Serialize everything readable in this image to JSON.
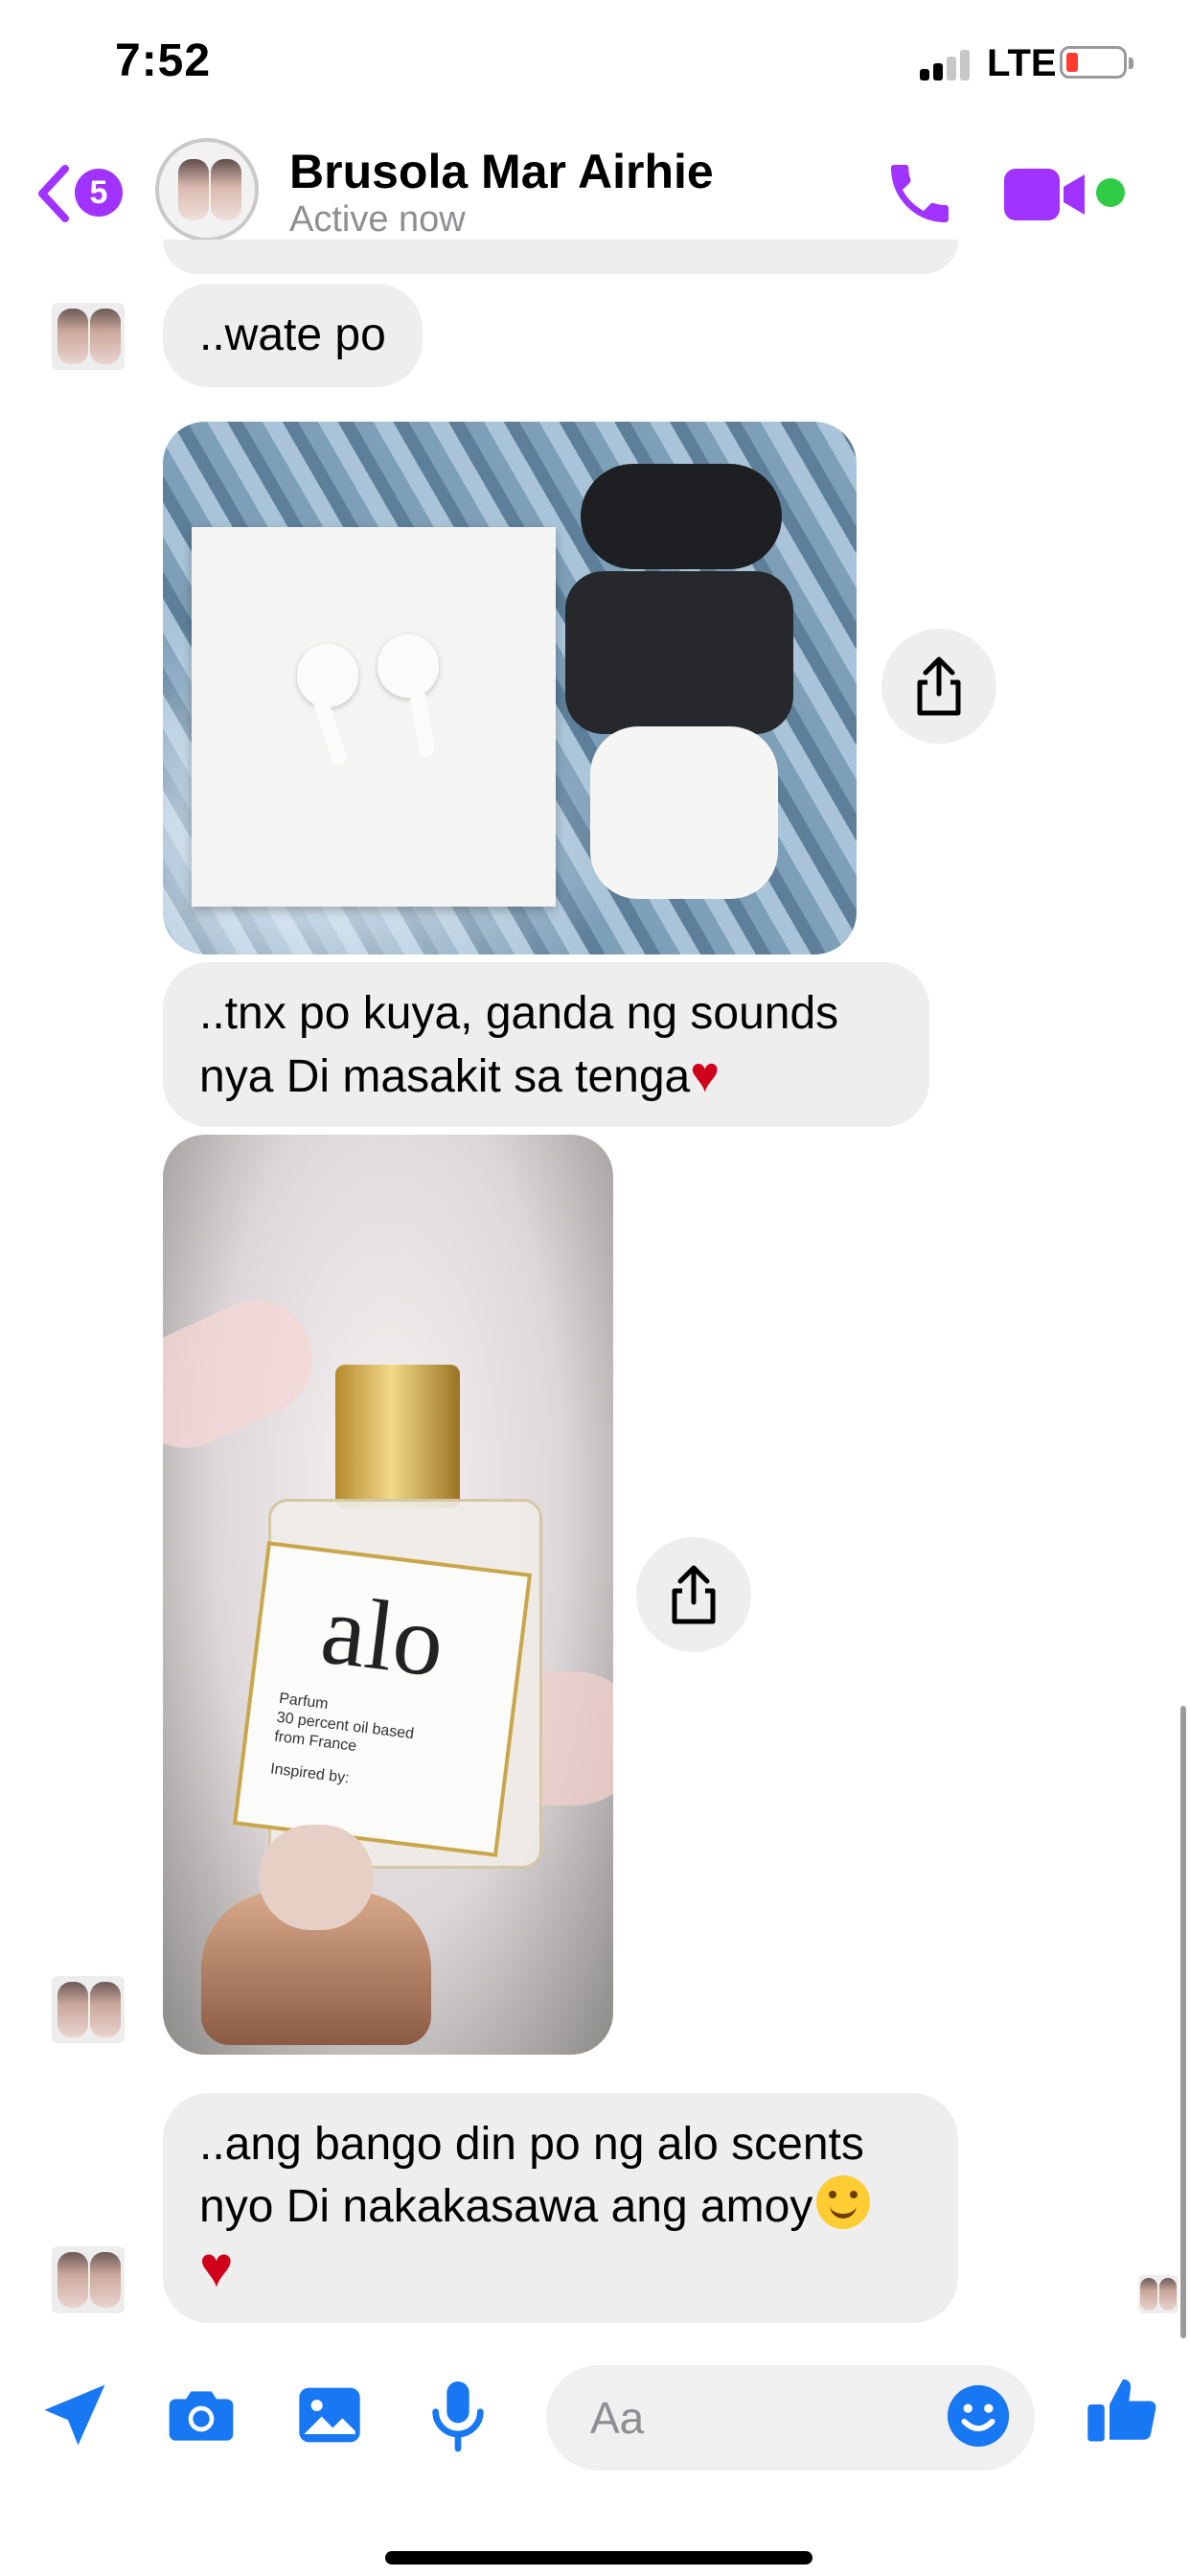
{
  "status_bar": {
    "time": "7:52",
    "network": "LTE",
    "battery_color": "#ff3b30"
  },
  "header": {
    "back_icon": "chevron-left-icon",
    "unread_count": "5",
    "contact_name": "Brusola Mar Airhie",
    "contact_status": "Active now",
    "accent_color": "#a033ff",
    "online_color": "#31cc46"
  },
  "messages": [
    {
      "type": "text",
      "text": "..wate po"
    },
    {
      "type": "photo",
      "subject": "airpods",
      "share_icon": "share-icon"
    },
    {
      "type": "text",
      "line1": "..tnx po kuya, ganda ng sounds",
      "line2": "nya Di masakit sa tenga",
      "emoji": "red-heart"
    },
    {
      "type": "photo",
      "subject": "perfume",
      "share_icon": "share-icon",
      "label_brand": "alo",
      "label_line1": "Parfum",
      "label_line2": "30 percent oil based",
      "label_line3": "from France",
      "label_line4": "Inspired by:"
    },
    {
      "type": "text",
      "line1": "..ang bango din po ng alo scents",
      "line2": "nyo Di nakakasawa ang amoy",
      "emoji1": "smiling-face",
      "emoji2": "red-heart"
    }
  ],
  "composer": {
    "placeholder": "Aa",
    "icons": [
      "location-arrow-icon",
      "camera-icon",
      "photo-gallery-icon",
      "microphone-icon",
      "emoji-icon",
      "thumbs-up-icon"
    ],
    "icon_color": "#1877f2"
  }
}
